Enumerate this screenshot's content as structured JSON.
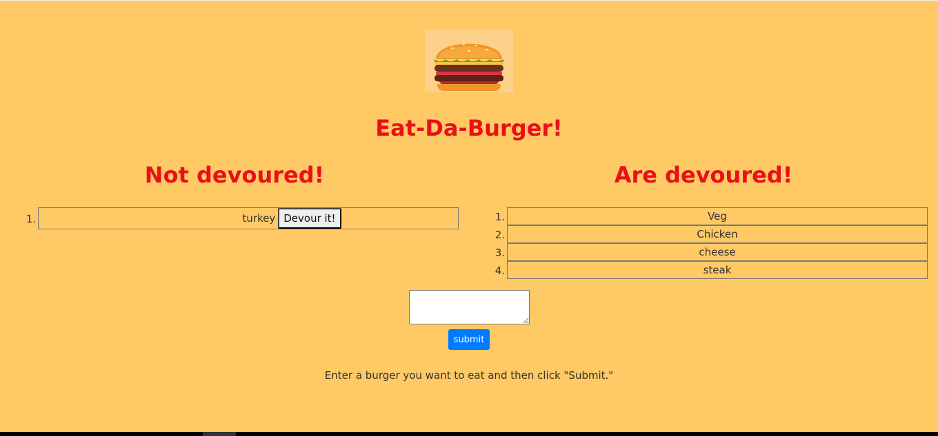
{
  "header": {
    "title": "Eat-Da-Burger!"
  },
  "not_devoured": {
    "heading": "Not devoured!",
    "items": [
      {
        "number": "1.",
        "name": "turkey",
        "button_label": "Devour it!"
      }
    ]
  },
  "devoured": {
    "heading": "Are devoured!",
    "items": [
      {
        "number": "1.",
        "name": "Veg"
      },
      {
        "number": "2.",
        "name": "Chicken"
      },
      {
        "number": "3.",
        "name": "cheese"
      },
      {
        "number": "4.",
        "name": "steak"
      }
    ]
  },
  "form": {
    "input_value": "",
    "submit_label": "submit",
    "instructions": "Enter a burger you want to eat and then click \"Submit.\""
  },
  "colors": {
    "background": "#ffc965",
    "heading": "#e8111a",
    "submit_button": "#007bff"
  },
  "icons": {
    "logo": "burger-icon"
  }
}
